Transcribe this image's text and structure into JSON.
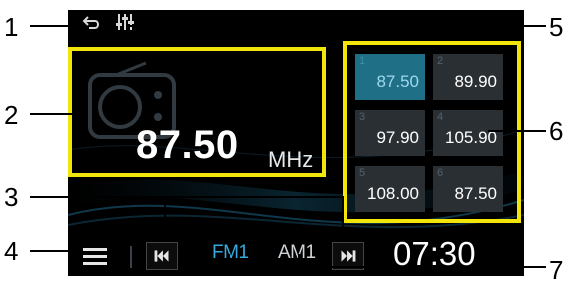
{
  "callouts": [
    "1",
    "2",
    "3",
    "4",
    "5",
    "6",
    "7"
  ],
  "main": {
    "frequency": "87.50",
    "unit": "MHz"
  },
  "presets": [
    {
      "num": "1",
      "value": "87.50",
      "active": true
    },
    {
      "num": "2",
      "value": "89.90",
      "active": false
    },
    {
      "num": "3",
      "value": "97.90",
      "active": false
    },
    {
      "num": "4",
      "value": "105.90",
      "active": false
    },
    {
      "num": "5",
      "value": "108.00",
      "active": false
    },
    {
      "num": "6",
      "value": "87.50",
      "active": false
    }
  ],
  "bottom": {
    "band_fm": "FM1",
    "band_am": "AM1",
    "clock": "07:30"
  },
  "colors": {
    "highlight_box": "#f1e50a",
    "active_preset": "#1f6f86",
    "active_band": "#37a9e0",
    "background": "#000000"
  },
  "icons": {
    "top_left": "back-icon",
    "top_second": "equalizer-icon",
    "radio": "radio-icon",
    "menu": "menu-icon",
    "prev": "skip-previous-icon",
    "next": "skip-next-icon"
  }
}
